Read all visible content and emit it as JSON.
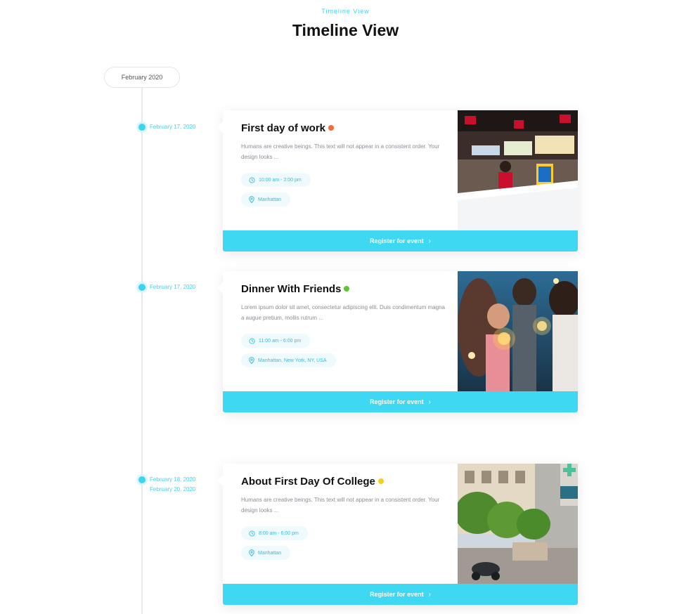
{
  "header": {
    "eyebrow": "Timeline View",
    "title": "Timeline View"
  },
  "timeline": {
    "month": "February 2020",
    "events": [
      {
        "dates": [
          "February 17, 2020"
        ],
        "title": "First day of work",
        "status_color": "#f26b3a",
        "description": "Humans are creative beings. This text will not appear in a consistent order. Your design looks ...",
        "time": "10:00 am - 2:00 pm",
        "location": "Manhattan",
        "image_icon": "restaurant-counter-photo",
        "cta": "Register for event"
      },
      {
        "dates": [
          "February 17, 2020"
        ],
        "title": "Dinner With Friends",
        "status_color": "#5cc82a",
        "description": "Lorem ipsum dolor sit amet, consectetur adipiscing elit. Duis condimentum magna a augue pretium, mollis rutrum ...",
        "time": "11:00 am - 6:00 pm",
        "location": "Manhattan, New York, NY, USA",
        "image_icon": "friends-sparklers-photo",
        "cta": "Register for event"
      },
      {
        "dates": [
          "February 18, 2020",
          "February 20, 2020"
        ],
        "title": "About First Day Of College",
        "status_color": "#f2d11c",
        "description": "Humans are creative beings. This text will not appear in a consistent order. Your design looks ...",
        "time": "8:00 am - 6:00 pm",
        "location": "Manhattan",
        "image_icon": "city-street-photo",
        "cta": "Register for event"
      }
    ]
  },
  "colors": {
    "accent": "#3fd3ee",
    "button": "#3fd8f2"
  }
}
